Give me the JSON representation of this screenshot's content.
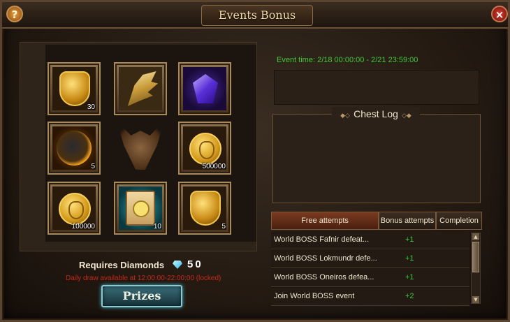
{
  "window": {
    "title": "Events Bonus",
    "help_label": "?",
    "close_label": "×"
  },
  "grid": {
    "items": [
      {
        "name": "gold-crest",
        "qty": "30"
      },
      {
        "name": "golden-wing",
        "qty": ""
      },
      {
        "name": "purple-gem",
        "qty": ""
      },
      {
        "name": "fire-orb",
        "qty": "5"
      },
      {
        "name": "gold-coin",
        "qty": "500000"
      },
      {
        "name": "gold-coin",
        "qty": "100000"
      },
      {
        "name": "smiley-scroll",
        "qty": "10"
      },
      {
        "name": "gold-crest",
        "qty": "5"
      }
    ]
  },
  "draw": {
    "requires_label": "Requires Diamonds",
    "cost": "50",
    "daily_note": "Daily draw available at 12:00:00-22:00:00 (locked)",
    "prizes_label": "Prizes"
  },
  "event": {
    "time": "Event time: 2/18 00:00:00 - 2/21 23:59:00"
  },
  "chest_log": {
    "title": "Chest Log",
    "entries": []
  },
  "tabs": [
    {
      "label": "Free attempts",
      "active": true
    },
    {
      "label": "Bonus attempts",
      "active": false
    },
    {
      "label": "Completion",
      "active": false
    }
  ],
  "tasks": [
    {
      "task": "World BOSS Fafnir defeat...",
      "bonus": "+1"
    },
    {
      "task": "World BOSS Lokmundr defe...",
      "bonus": "+1"
    },
    {
      "task": "World BOSS Oneiros defea...",
      "bonus": "+1"
    },
    {
      "task": "Join World BOSS event",
      "bonus": "+2"
    }
  ],
  "colors": {
    "accent_green": "#3ec83a",
    "warning_red": "#c82818",
    "title_gold": "#f0d9a6"
  }
}
